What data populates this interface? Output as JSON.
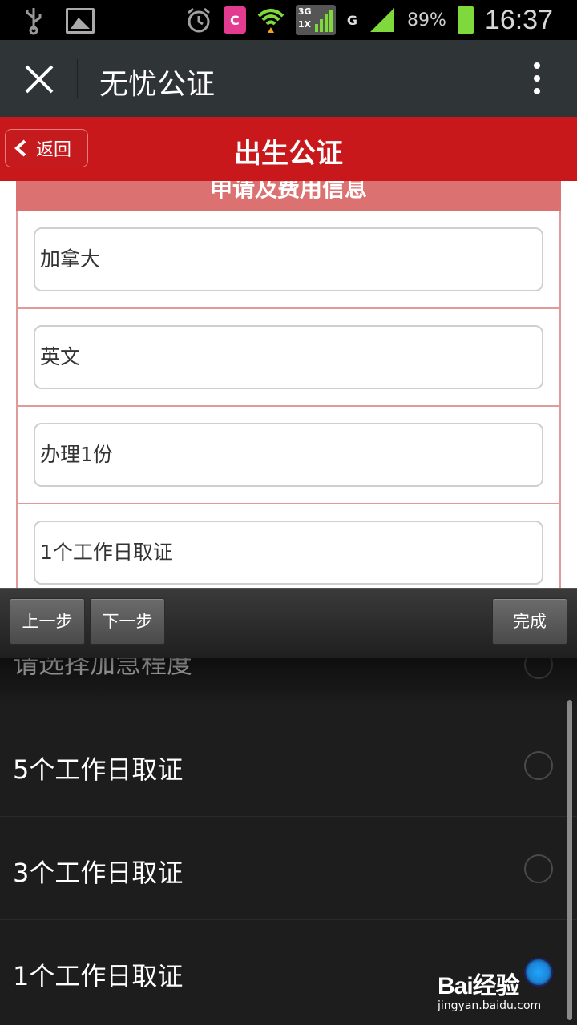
{
  "statusbar": {
    "network_top": "3G",
    "network_bottom": "1X",
    "network_g": "G",
    "battery": "89%",
    "time": "16:37",
    "icons": [
      "usb-icon",
      "image-icon",
      "alarm-icon",
      "c-icon",
      "wifi-icon",
      "signal-icon",
      "battery-icon"
    ],
    "c_label": "C"
  },
  "titlebar": {
    "title": "无忧公证"
  },
  "header": {
    "back_label": "返回",
    "page_title": "出生公证",
    "color": "#c8181b"
  },
  "form": {
    "section_title": "申请及费用信息",
    "fields": [
      {
        "value": "加拿大"
      },
      {
        "value": "英文"
      },
      {
        "value": "办理1份"
      },
      {
        "value": "1个工作日取证"
      }
    ]
  },
  "toolbar": {
    "prev_label": "上一步",
    "next_label": "下一步",
    "done_label": "完成"
  },
  "picker": {
    "header": "请选择加急程度",
    "options": [
      {
        "label": "5个工作日取证",
        "selected": false
      },
      {
        "label": "3个工作日取证",
        "selected": false
      },
      {
        "label": "1个工作日取证",
        "selected": true
      }
    ]
  },
  "watermark": {
    "main": "Bai经验",
    "sub": "jingyan.baidu.com"
  }
}
